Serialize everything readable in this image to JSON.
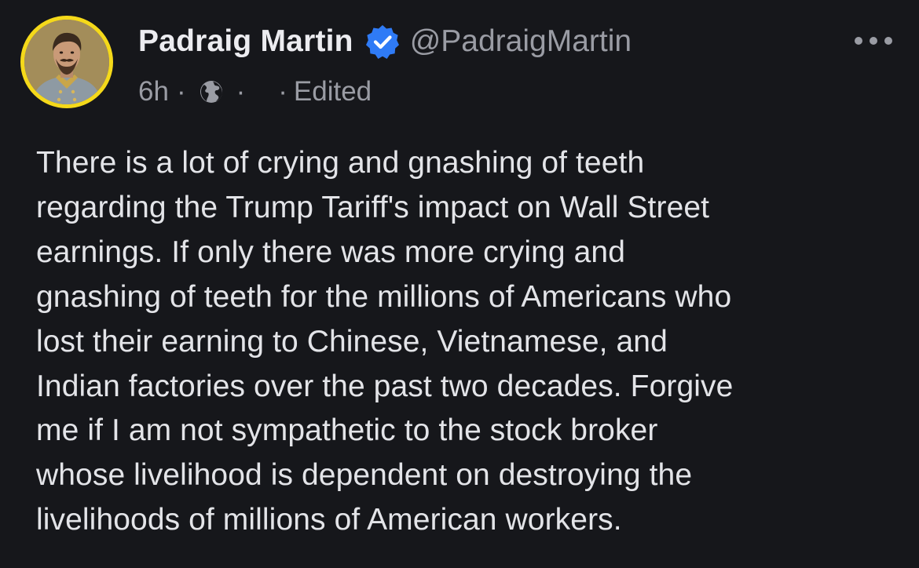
{
  "post": {
    "author": {
      "display_name": "Padraig Martin",
      "handle": "@PadraigMartin",
      "verified": true,
      "avatar_icon": "portrait-avatar"
    },
    "meta": {
      "time": "6h",
      "separator": "·",
      "visibility_icon": "globe-icon",
      "edited_label": "Edited"
    },
    "more_icon": "more-options-icon",
    "text_lines": [
      "There is a lot of crying and gnashing of teeth",
      "regarding the Trump Tariff's impact on Wall Street",
      "earnings. If only there was more crying and",
      "gnashing of teeth for the millions of Americans who",
      "lost their earning to Chinese, Vietnamese, and",
      "Indian factories over the past two decades. Forgive",
      "me if I am not sympathetic to the stock broker",
      "whose livelihood is dependent on destroying the",
      "livelihoods of millions of American workers."
    ]
  },
  "colors": {
    "background": "#16171b",
    "text": "#e3e4e8",
    "secondary_text": "#9a9ca4",
    "verified_badge": "#2f7bf6",
    "avatar_ring": "#f5d91a"
  }
}
